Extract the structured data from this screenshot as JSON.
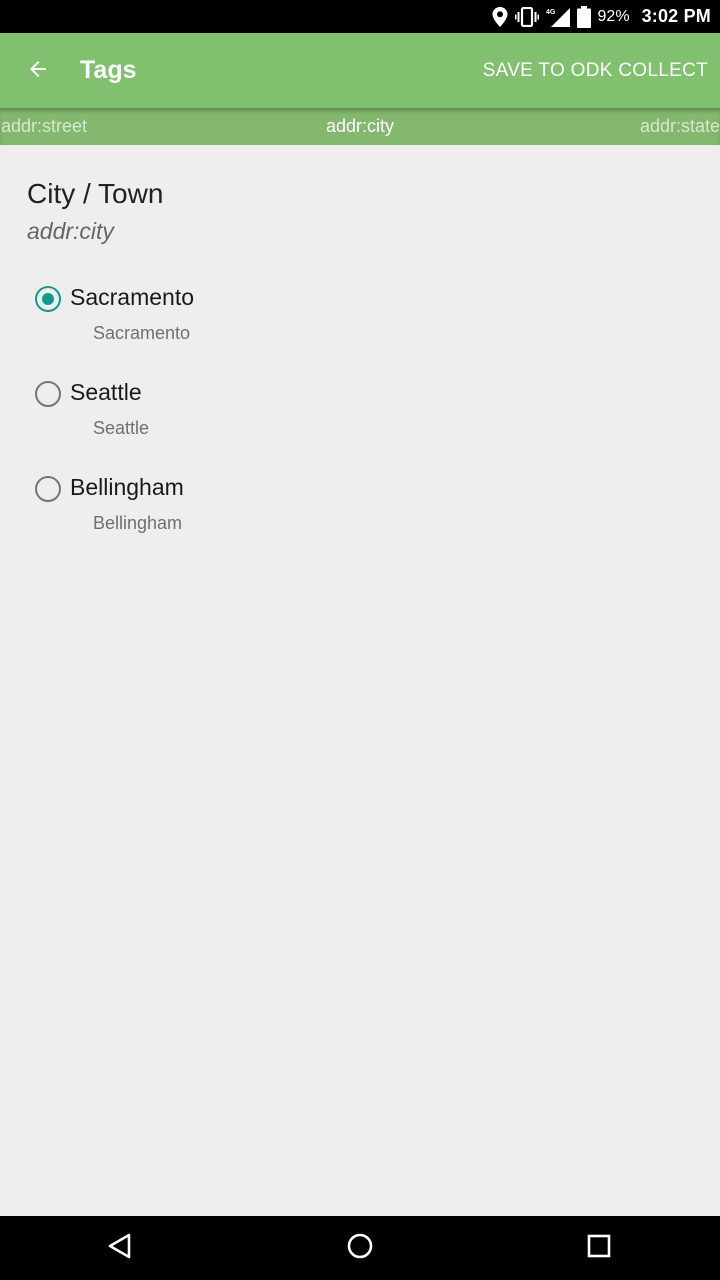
{
  "status_bar": {
    "battery_percent": "92%",
    "time": "3:02 PM",
    "icons": [
      "location-icon",
      "vibrate-icon",
      "4g-signal-icon",
      "battery-icon"
    ]
  },
  "app_bar": {
    "title": "Tags",
    "action_label": "SAVE TO ODK COLLECT",
    "background": "#81c06f"
  },
  "tag_strip": {
    "previous": "addr:street",
    "current": "addr:city",
    "next": "addr:state"
  },
  "question": {
    "title": "City / Town",
    "key": "addr:city"
  },
  "options": [
    {
      "label": "Sacramento",
      "value": "Sacramento",
      "selected": true
    },
    {
      "label": "Seattle",
      "value": "Seattle",
      "selected": false
    },
    {
      "label": "Bellingham",
      "value": "Bellingham",
      "selected": false
    }
  ],
  "colors": {
    "accent": "#139c8c",
    "toolbar": "#81c06f",
    "background": "#eeeeee"
  },
  "nav_bar": {
    "icons": [
      "back-triangle-icon",
      "home-circle-icon",
      "recents-square-icon"
    ]
  }
}
